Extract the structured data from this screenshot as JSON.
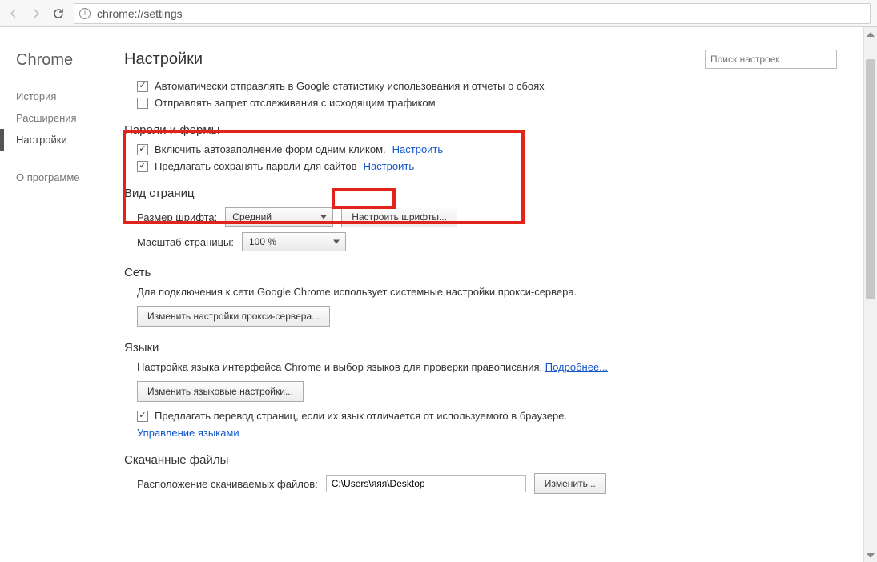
{
  "address_bar": "chrome://settings",
  "brand": "Chrome",
  "sidebar": {
    "history": "История",
    "extensions": "Расширения",
    "settings": "Настройки",
    "about": "О программе"
  },
  "page_title": "Настройки",
  "search_placeholder": "Поиск настроек",
  "privacy": {
    "send_stats": "Автоматически отправлять в Google статистику использования и отчеты о сбоях",
    "do_not_track": "Отправлять запрет отслеживания с исходящим трафиком"
  },
  "passwords": {
    "title": "Пароли и формы",
    "autofill": "Включить автозаполнение форм одним кликом.",
    "autofill_link": "Настроить",
    "save_pw": "Предлагать сохранять пароли для сайтов",
    "save_pw_link": "Настроить"
  },
  "view": {
    "title": "Вид страниц",
    "font_size_label": "Размер шрифта:",
    "font_size_value": "Средний",
    "font_btn": "Настроить шрифты...",
    "zoom_label": "Масштаб страницы:",
    "zoom_value": "100 %"
  },
  "network": {
    "title": "Сеть",
    "desc": "Для подключения к сети Google Chrome использует системные настройки прокси-сервера.",
    "proxy_btn": "Изменить настройки прокси-сервера..."
  },
  "languages": {
    "title": "Языки",
    "desc_pre": "Настройка языка интерфейса Chrome и выбор языков для проверки правописания.",
    "learn_more": "Подробнее...",
    "change_btn": "Изменить языковые настройки...",
    "translate_offer": "Предлагать перевод страниц, если их язык отличается от используемого в браузере.",
    "manage_link": "Управление языками"
  },
  "downloads": {
    "title": "Скачанные файлы",
    "location_label": "Расположение скачиваемых файлов:",
    "location_value": "C:\\Users\\яяя\\Desktop",
    "change_btn": "Изменить..."
  }
}
